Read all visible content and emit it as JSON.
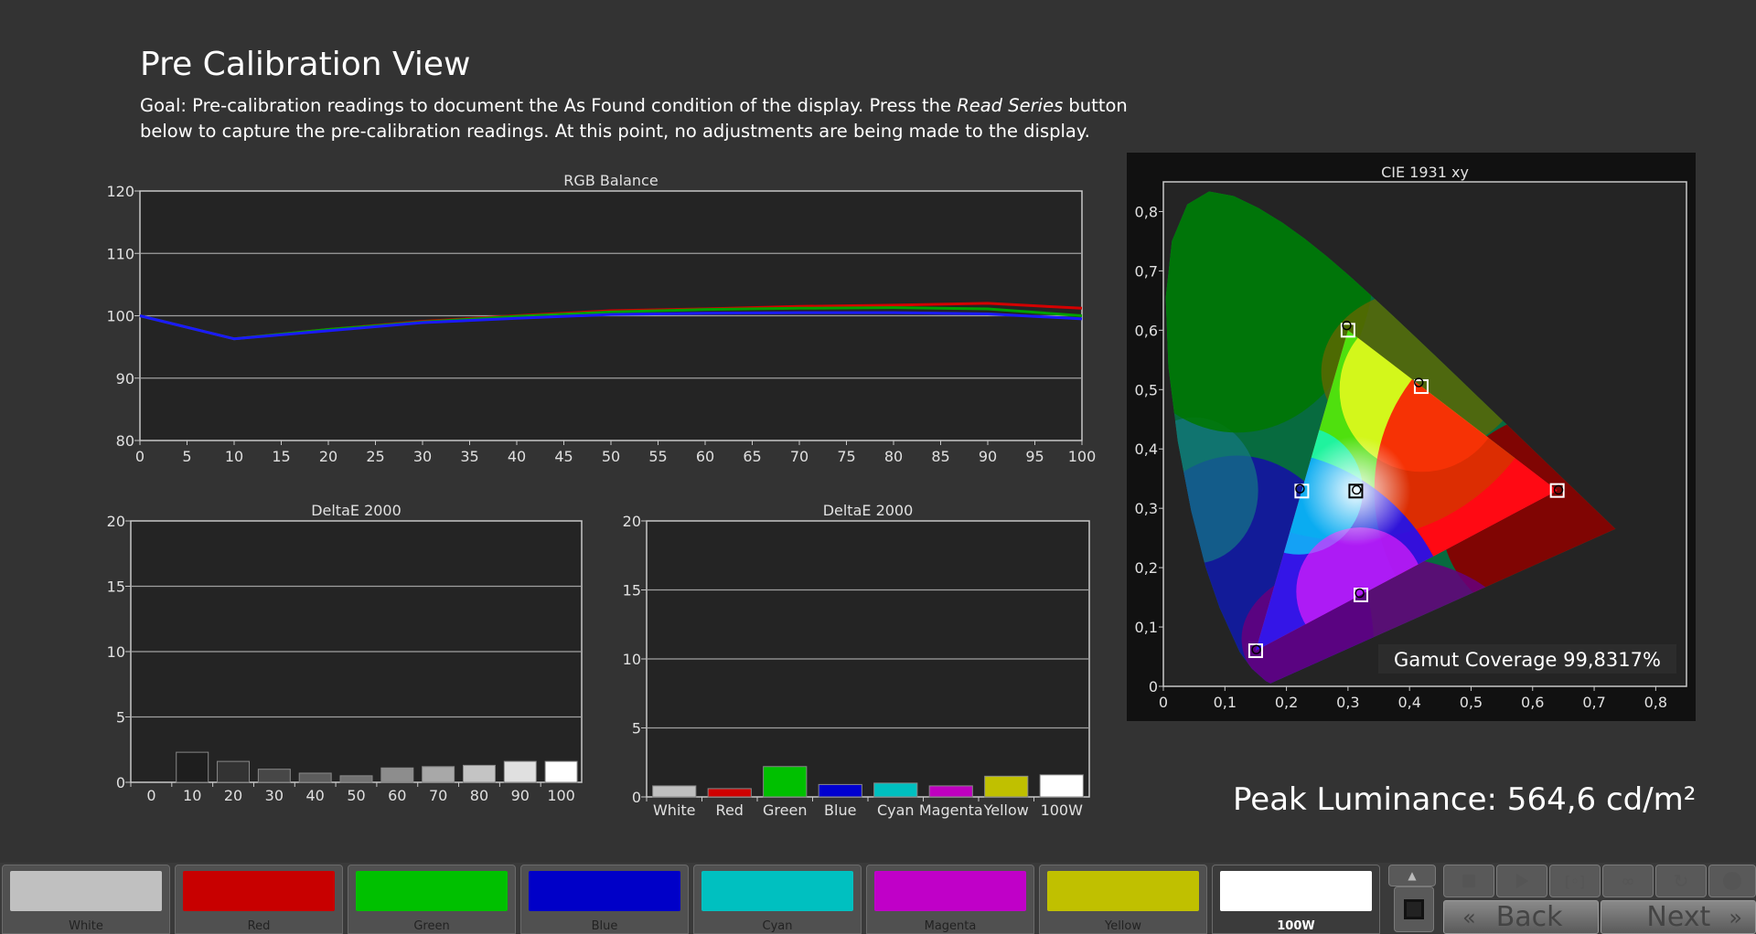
{
  "page": {
    "title": "Pre Calibration View",
    "goal_before": "Goal: Pre-calibration readings to document the As Found condition of the display. Press the ",
    "goal_emph": "Read Series",
    "goal_after": " button below to capture the pre-calibration readings. At this point, no adjustments are being made to the display."
  },
  "peak_luminance": "Peak Luminance: 564,6 cd/m²",
  "gamut_coverage": "Gamut Coverage 99,8317%",
  "colors": {
    "background": "#333333",
    "plot_bg": "#242424",
    "grid": "#a0a0a0",
    "red_series": "#d40000",
    "green_series": "#00a000",
    "blue_series": "#1a1aff"
  },
  "chart_data": [
    {
      "type": "line",
      "title": "RGB Balance",
      "x": [
        0,
        10,
        20,
        30,
        40,
        50,
        60,
        70,
        80,
        90,
        100
      ],
      "xticks": [
        0,
        5,
        10,
        15,
        20,
        25,
        30,
        35,
        40,
        45,
        50,
        55,
        60,
        65,
        70,
        75,
        80,
        85,
        90,
        95,
        100
      ],
      "ylim": [
        80,
        120
      ],
      "yticks": [
        80,
        90,
        100,
        110,
        120
      ],
      "grid": true,
      "series": [
        {
          "color": "#d40000",
          "values": [
            100,
            96.3,
            97.8,
            99.1,
            100,
            100.8,
            101.1,
            101.5,
            101.7,
            102.0,
            101.2
          ]
        },
        {
          "color": "#00a000",
          "values": [
            100,
            96.3,
            97.8,
            99.0,
            99.9,
            100.6,
            101.0,
            101.2,
            101.3,
            101.1,
            100.0
          ]
        },
        {
          "color": "#1a1aff",
          "values": [
            100,
            96.3,
            97.6,
            98.9,
            99.6,
            100.2,
            100.4,
            100.5,
            100.5,
            100.3,
            99.5
          ]
        }
      ]
    },
    {
      "type": "bar",
      "title": "DeltaE 2000",
      "categories": [
        "0",
        "10",
        "20",
        "30",
        "40",
        "50",
        "60",
        "70",
        "80",
        "90",
        "100"
      ],
      "values": [
        0,
        2.3,
        1.6,
        1.0,
        0.7,
        0.5,
        1.1,
        1.2,
        1.3,
        1.6,
        1.6
      ],
      "bar_colors": [
        "#000000",
        "#1e1e1e",
        "#333333",
        "#474747",
        "#5c5c5c",
        "#727272",
        "#8d8d8d",
        "#a8a8a8",
        "#c4c4c4",
        "#e0e0e0",
        "#ffffff"
      ],
      "ylim": [
        0,
        20
      ],
      "yticks": [
        0,
        5,
        10,
        15,
        20
      ],
      "grid": true
    },
    {
      "type": "bar",
      "title": "DeltaE 2000",
      "categories": [
        "White",
        "Red",
        "Green",
        "Blue",
        "Cyan",
        "Magenta",
        "Yellow",
        "100W"
      ],
      "values": [
        0.8,
        0.6,
        2.2,
        0.9,
        1.0,
        0.8,
        1.5,
        1.6
      ],
      "bar_colors": [
        "#c0c0c0",
        "#d00000",
        "#00c000",
        "#0000d0",
        "#00c0c0",
        "#c000c0",
        "#c0c000",
        "#ffffff"
      ],
      "ylim": [
        0,
        20
      ],
      "yticks": [
        0,
        5,
        10,
        15,
        20
      ],
      "grid": true
    },
    {
      "type": "scatter",
      "title": "CIE 1931 xy",
      "xlim": [
        0,
        0.85
      ],
      "ylim": [
        0,
        0.85
      ],
      "xticks": [
        "0",
        "0,1",
        "0,2",
        "0,3",
        "0,4",
        "0,5",
        "0,6",
        "0,7",
        "0,8"
      ],
      "yticks": [
        "0",
        "0,1",
        "0,2",
        "0,3",
        "0,4",
        "0,5",
        "0,6",
        "0,7",
        "0,8"
      ],
      "targets": [
        {
          "name": "Red",
          "x": 0.64,
          "y": 0.33
        },
        {
          "name": "Green",
          "x": 0.3,
          "y": 0.6
        },
        {
          "name": "Blue",
          "x": 0.15,
          "y": 0.06
        },
        {
          "name": "Cyan",
          "x": 0.225,
          "y": 0.329
        },
        {
          "name": "Magenta",
          "x": 0.321,
          "y": 0.154
        },
        {
          "name": "Yellow",
          "x": 0.419,
          "y": 0.505
        },
        {
          "name": "White",
          "x": 0.3127,
          "y": 0.329
        }
      ],
      "measured": [
        {
          "x": 0.642,
          "y": 0.331
        },
        {
          "x": 0.298,
          "y": 0.608
        },
        {
          "x": 0.151,
          "y": 0.062
        },
        {
          "x": 0.222,
          "y": 0.333
        },
        {
          "x": 0.319,
          "y": 0.157
        },
        {
          "x": 0.415,
          "y": 0.512
        },
        {
          "x": 0.314,
          "y": 0.331
        }
      ]
    }
  ],
  "swatches": [
    {
      "label": "White",
      "color": "#c0c0c0"
    },
    {
      "label": "Red",
      "color": "#c80000"
    },
    {
      "label": "Green",
      "color": "#00c000"
    },
    {
      "label": "Blue",
      "color": "#0000c8"
    },
    {
      "label": "Cyan",
      "color": "#00c0c0"
    },
    {
      "label": "Magenta",
      "color": "#c000c8"
    },
    {
      "label": "Yellow",
      "color": "#c0c000"
    },
    {
      "label": "100W",
      "color": "#ffffff"
    }
  ],
  "nav": {
    "back": "Back",
    "next": "Next"
  }
}
